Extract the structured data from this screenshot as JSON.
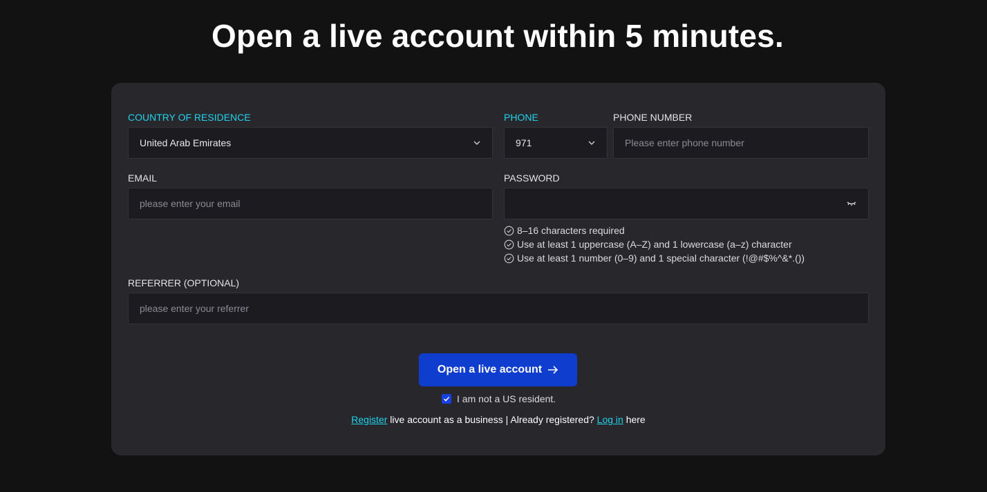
{
  "title": "Open a live account within 5 minutes.",
  "form": {
    "country": {
      "label": "COUNTRY OF RESIDENCE",
      "value": "United Arab Emirates"
    },
    "phone_code": {
      "label": "PHONE",
      "value": "971"
    },
    "phone_number": {
      "label": "PHONE NUMBER",
      "placeholder": "Please enter phone number"
    },
    "email": {
      "label": "EMAIL",
      "placeholder": "please enter your email"
    },
    "password": {
      "label": "PASSWORD",
      "rules": [
        "8–16 characters required",
        "Use at least 1 uppercase (A–Z) and 1 lowercase (a–z) character",
        "Use at least 1 number (0–9) and 1 special character (!@#$%^&*.())"
      ]
    },
    "referrer": {
      "label": "REFERRER (OPTIONAL)",
      "placeholder": "please enter your referrer"
    },
    "submit_label": "Open a live account",
    "resident_label": "I am not a US resident.",
    "resident_checked": true
  },
  "footer": {
    "register_link": "Register",
    "middle_text": " live account as a business | Already registered? ",
    "login_link": "Log in",
    "end_text": " here"
  },
  "colors": {
    "accent": "#22d3ee",
    "button": "#0f3dce",
    "card": "#27272c",
    "background": "#121213"
  }
}
